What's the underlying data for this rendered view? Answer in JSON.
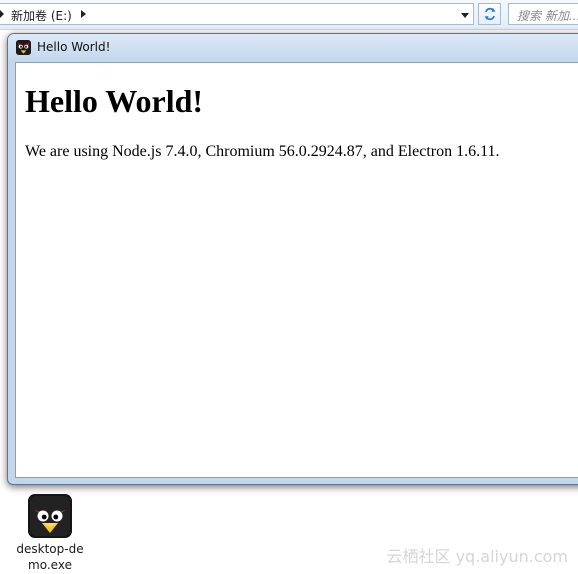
{
  "explorer": {
    "address": "新加卷 (E:)",
    "search_placeholder": "搜索 新加..."
  },
  "window": {
    "title": "Hello World!",
    "icon": "angry-bird-icon"
  },
  "page": {
    "heading": "Hello World!",
    "body": "We are using Node.js 7.4.0, Chromium 56.0.2924.87, and Electron 1.6.11."
  },
  "desktop": {
    "icon_label": "desktop-demo.exe",
    "icon": "angry-bird-icon"
  },
  "watermark": "云栖社区 yq.aliyun.com",
  "colors": {
    "window_frame": "#c4d6ea",
    "title_gradient_top": "#dce9f7",
    "refresh_accent": "#2d7fd6"
  }
}
